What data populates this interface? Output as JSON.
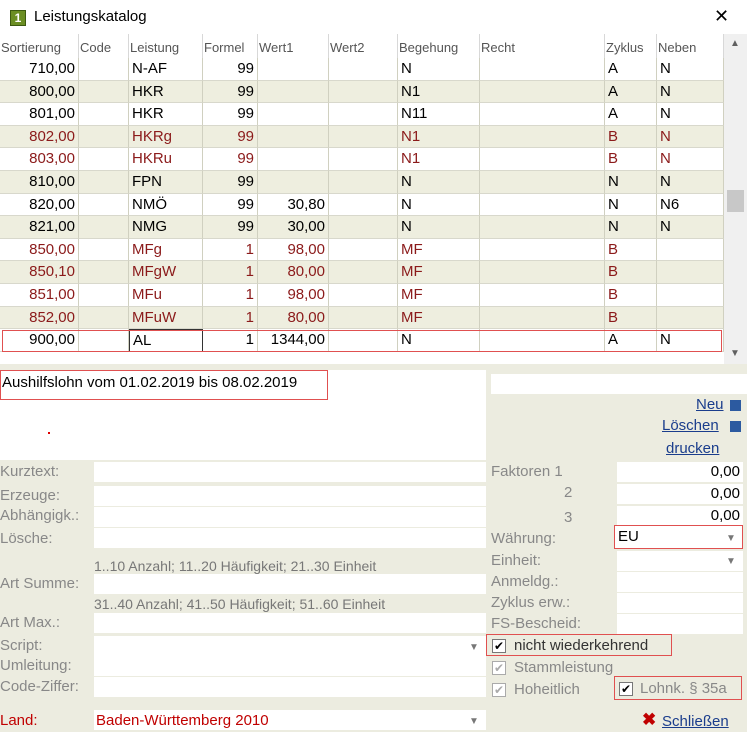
{
  "window": {
    "title": "Leistungskatalog",
    "icon_text": "1",
    "close_glyph": "✕"
  },
  "table": {
    "columns": [
      "Sortierung",
      "Code",
      "Leistung",
      "Formel",
      "Wert1",
      "Wert2",
      "Begehung",
      "Recht",
      "Zyklus",
      "Neben"
    ],
    "rows": [
      {
        "sortierung": "710,00",
        "code": "",
        "leistung": "N-AF",
        "formel": "99",
        "wert1": "",
        "wert2": "",
        "begehung": "N",
        "recht": "",
        "zyklus": "A",
        "neben": "N",
        "style": "normal"
      },
      {
        "sortierung": "800,00",
        "code": "",
        "leistung": "HKR",
        "formel": "99",
        "wert1": "",
        "wert2": "",
        "begehung": "N1",
        "recht": "",
        "zyklus": "A",
        "neben": "N",
        "style": "normal"
      },
      {
        "sortierung": "801,00",
        "code": "",
        "leistung": "HKR",
        "formel": "99",
        "wert1": "",
        "wert2": "",
        "begehung": "N11",
        "recht": "",
        "zyklus": "A",
        "neben": "N",
        "style": "normal"
      },
      {
        "sortierung": "802,00",
        "code": "",
        "leistung": "HKRg",
        "formel": "99",
        "wert1": "",
        "wert2": "",
        "begehung": "N1",
        "recht": "",
        "zyklus": "B",
        "neben": "N",
        "style": "red"
      },
      {
        "sortierung": "803,00",
        "code": "",
        "leistung": "HKRu",
        "formel": "99",
        "wert1": "",
        "wert2": "",
        "begehung": "N1",
        "recht": "",
        "zyklus": "B",
        "neben": "N",
        "style": "red"
      },
      {
        "sortierung": "810,00",
        "code": "",
        "leistung": "FPN",
        "formel": "99",
        "wert1": "",
        "wert2": "",
        "begehung": "N",
        "recht": "",
        "zyklus": "N",
        "neben": "N",
        "style": "normal"
      },
      {
        "sortierung": "820,00",
        "code": "",
        "leistung": "NMÖ",
        "formel": "99",
        "wert1": "30,80",
        "wert2": "",
        "begehung": "N",
        "recht": "",
        "zyklus": "N",
        "neben": "N6",
        "style": "normal"
      },
      {
        "sortierung": "821,00",
        "code": "",
        "leistung": "NMG",
        "formel": "99",
        "wert1": "30,00",
        "wert2": "",
        "begehung": "N",
        "recht": "",
        "zyklus": "N",
        "neben": "N",
        "style": "normal"
      },
      {
        "sortierung": "850,00",
        "code": "",
        "leistung": "MFg",
        "formel": "1",
        "wert1": "98,00",
        "wert2": "",
        "begehung": "MF",
        "recht": "",
        "zyklus": "B",
        "neben": "",
        "style": "red"
      },
      {
        "sortierung": "850,10",
        "code": "",
        "leistung": "MFgW",
        "formel": "1",
        "wert1": "80,00",
        "wert2": "",
        "begehung": "MF",
        "recht": "",
        "zyklus": "B",
        "neben": "",
        "style": "red"
      },
      {
        "sortierung": "851,00",
        "code": "",
        "leistung": "MFu",
        "formel": "1",
        "wert1": "98,00",
        "wert2": "",
        "begehung": "MF",
        "recht": "",
        "zyklus": "B",
        "neben": "",
        "style": "red"
      },
      {
        "sortierung": "852,00",
        "code": "",
        "leistung": "MFuW",
        "formel": "1",
        "wert1": "80,00",
        "wert2": "",
        "begehung": "MF",
        "recht": "",
        "zyklus": "B",
        "neben": "",
        "style": "red"
      },
      {
        "sortierung": "900,00",
        "code": "",
        "leistung": "AL",
        "formel": "1",
        "wert1": "1344,00",
        "wert2": "",
        "begehung": "N",
        "recht": "",
        "zyklus": "A",
        "neben": "N",
        "style": "selected"
      }
    ]
  },
  "notes": {
    "text": "Aushilfslohn vom 01.02.2019 bis 08.02.2019"
  },
  "actions": {
    "neu": "Neu",
    "loeschen": "Löschen",
    "drucken": "drucken",
    "schliessen": "Schließen"
  },
  "form": {
    "kurztext": "Kurztext:",
    "erzeuge": "Erzeuge:",
    "abhaengigk": "Abhängigk.:",
    "loesche": "Lösche:",
    "hint_summe": "1..10 Anzahl; 11..20 Häufigkeit; 21..30 Einheit",
    "art_summe": "Art Summe:",
    "hint_max": "31..40 Anzahl; 41..50 Häufigkeit; 51..60 Einheit",
    "art_max": "Art Max.:",
    "script": "Script:",
    "umleitung": "Umleitung:",
    "code_ziffer": "Code-Ziffer:",
    "land_label": "Land:",
    "land_value": "Baden-Württemberg 2010"
  },
  "right": {
    "faktoren_label": "Faktoren 1",
    "faktor2_label": "2",
    "faktor3_label": "3",
    "faktor1": "0,00",
    "faktor2": "0,00",
    "faktor3": "0,00",
    "waehrung_label": "Währung:",
    "waehrung_value": "EU",
    "einheit_label": "Einheit:",
    "anmeldg_label": "Anmeldg.:",
    "zyklus_erw_label": "Zyklus erw.:",
    "fs_bescheid_label": "FS-Bescheid:",
    "cb_nicht_wiederkehrend": "nicht wiederkehrend",
    "cb_stammleistung": "Stammleistung",
    "cb_hoheitlich": "Hoheitlich",
    "cb_lohnk": "Lohnk. § 35a",
    "check_glyph": "✔"
  },
  "colors": {
    "row_alt": "#eeeedf",
    "red_text": "#8b1a1a",
    "panel": "#ecece0",
    "link": "#1a3d8c",
    "highlight_box": "#e05050"
  }
}
